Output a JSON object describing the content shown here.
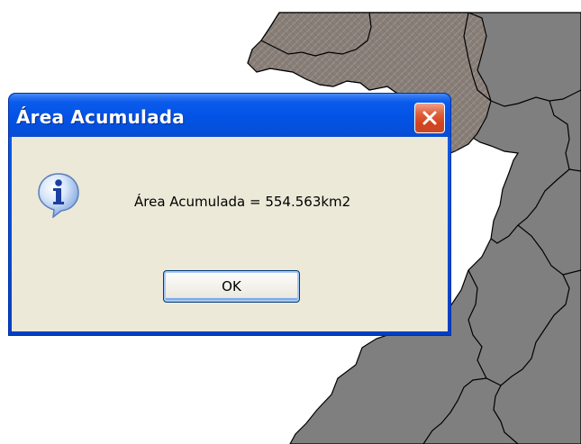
{
  "dialog": {
    "title": "Área Acumulada",
    "message": "Área Acumulada = 554.563km2",
    "ok_label": "OK",
    "icon": "information-icon",
    "close_icon": "close-icon"
  },
  "colors": {
    "titlebar": "#0453e6",
    "dialog_body": "#ece9d8",
    "close_button": "#d2431c",
    "map_region": "#808080",
    "map_highlight": "#8a7f78",
    "map_border": "#000000"
  }
}
